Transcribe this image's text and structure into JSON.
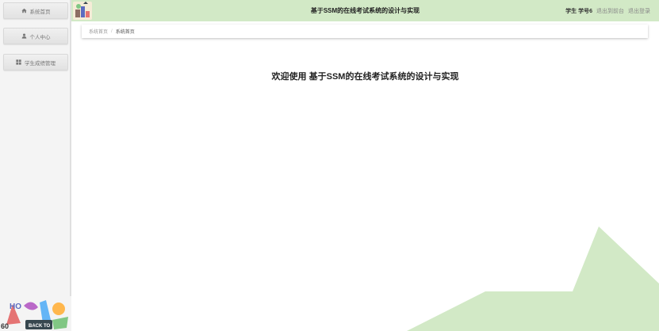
{
  "header": {
    "title": "基于SSM的在线考试系统的设计与实现",
    "user_text": "学生 学号6",
    "back_label": "退出到前台",
    "logout_label": "退出登录",
    "bg_color": "#d2e9c6"
  },
  "sidebar": {
    "items": [
      {
        "label": "系统首页",
        "icon": "home-icon"
      },
      {
        "label": "个人中心",
        "icon": "user-icon"
      },
      {
        "label": "学生成绩管理",
        "icon": "grid-icon"
      }
    ],
    "decoration_text": [
      "HO",
      "BACK TO"
    ]
  },
  "breadcrumb": {
    "home": "系统首页",
    "separator": "/",
    "current": "系统首页"
  },
  "main": {
    "welcome": "欢迎使用 基于SSM的在线考试系统的设计与实现"
  },
  "colors": {
    "accent_green": "#d2e9c6",
    "sidebar_bg": "#f4f4f4"
  }
}
